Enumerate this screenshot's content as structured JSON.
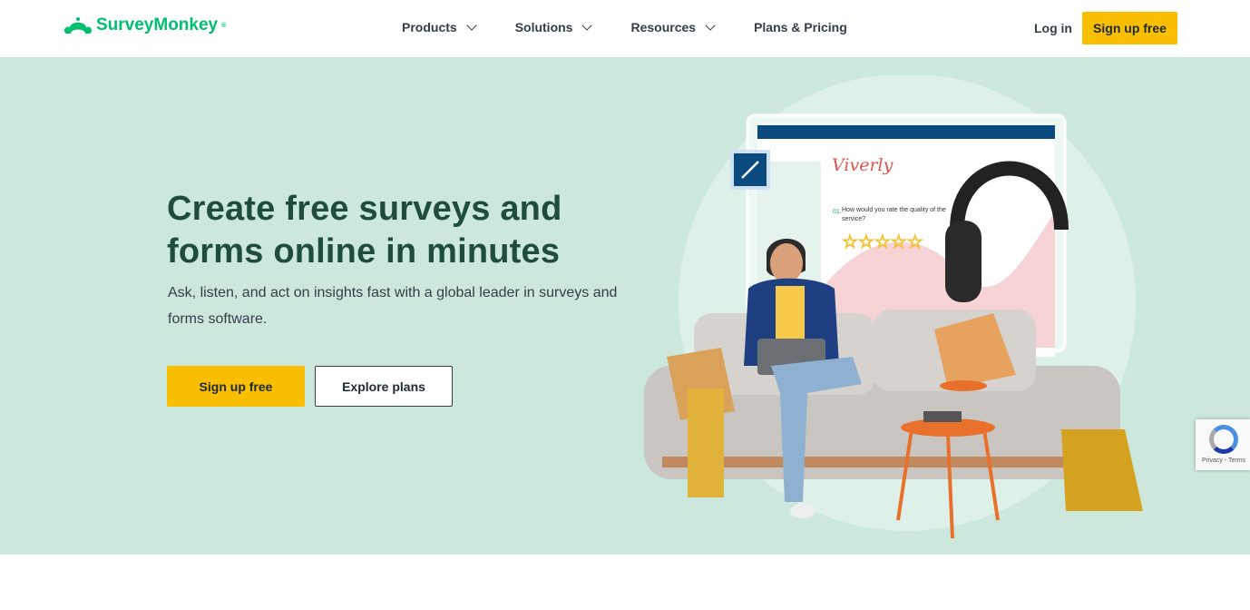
{
  "nav": {
    "logo": "SurveyMonkey",
    "items": [
      {
        "label": "Products",
        "dropdown": true
      },
      {
        "label": "Solutions",
        "dropdown": true
      },
      {
        "label": "Resources",
        "dropdown": true
      },
      {
        "label": "Plans & Pricing",
        "dropdown": false
      }
    ],
    "login": "Log in",
    "signup": "Sign up free"
  },
  "hero": {
    "title_line1": "Create free surveys and",
    "title_line2": "forms online in minutes",
    "subtitle": "Ask, listen, and act on insights fast with a global leader in surveys and forms software.",
    "primary_button": "Sign up free",
    "secondary_button": "Explore plans",
    "illustration": {
      "brand": "Viverly",
      "question_number": "01.",
      "question": "How would you rate the quality of the service?",
      "stars": 5
    }
  },
  "recaptcha": {
    "links": "Privacy - Terms"
  },
  "colors": {
    "brand": "#00bf6f",
    "cta": "#f9be00",
    "hero_bg": "#cce8dc",
    "heading": "#1f4d3d"
  }
}
